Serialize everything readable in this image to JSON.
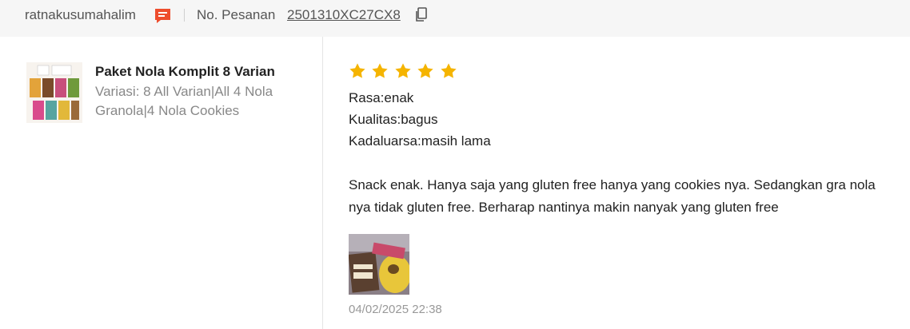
{
  "header": {
    "username": "ratnakusumahalim",
    "order_label": "No. Pesanan",
    "order_number": "2501310XC27CX8"
  },
  "product": {
    "name": "Paket Nola Komplit 8 Varian",
    "variant": "Variasi: 8 All Varian|All 4 Nola Granola|4 Nola Cookies"
  },
  "review": {
    "rating": 5,
    "attributes": [
      "Rasa:enak",
      "Kualitas:bagus",
      "Kadaluarsa:masih lama"
    ],
    "text": "Snack enak. Hanya saja yang gluten free hanya yang cookies nya. Sedangkan gra nola nya tidak gluten free. Berharap nantinya makin nanyak yang gluten free",
    "timestamp": "04/02/2025 22:38"
  },
  "colors": {
    "star": "#f5b400",
    "chat_icon": "#ee4d2d"
  }
}
